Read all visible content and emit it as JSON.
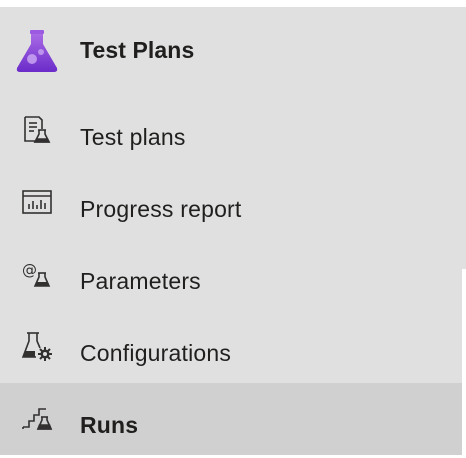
{
  "header": {
    "title": "Test Plans",
    "icon": "flask-icon"
  },
  "items": [
    {
      "label": "Test plans",
      "icon": "test-plans-icon"
    },
    {
      "label": "Progress report",
      "icon": "progress-report-icon"
    },
    {
      "label": "Parameters",
      "icon": "parameters-icon"
    },
    {
      "label": "Configurations",
      "icon": "configurations-icon"
    },
    {
      "label": "Runs",
      "icon": "runs-icon",
      "selected": true
    }
  ],
  "colors": {
    "accent": "#773adc",
    "nav_bg": "#e0e0e0",
    "selected_bg": "#d0d0d0"
  }
}
